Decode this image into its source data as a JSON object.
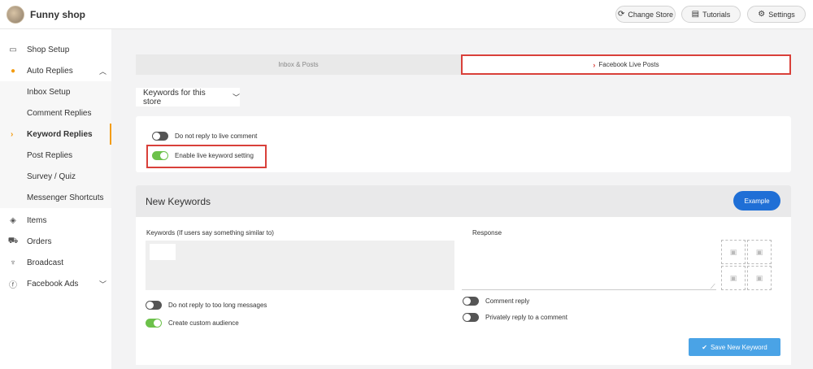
{
  "header": {
    "shop_name": "Funny shop",
    "buttons": {
      "change_store": "Change Store",
      "tutorials": "Tutorials",
      "settings": "Settings"
    }
  },
  "sidebar": {
    "items": [
      {
        "label": "Shop Setup",
        "icon": "shop-icon"
      },
      {
        "label": "Auto Replies",
        "icon": "chat-bubble-icon",
        "expanded": true
      },
      {
        "label": "Inbox Setup"
      },
      {
        "label": "Comment Replies"
      },
      {
        "label": "Keyword Replies",
        "active": true
      },
      {
        "label": "Post Replies"
      },
      {
        "label": "Survey / Quiz"
      },
      {
        "label": "Messenger Shortcuts"
      },
      {
        "label": "Items",
        "icon": "box-icon"
      },
      {
        "label": "Orders",
        "icon": "cart-icon"
      },
      {
        "label": "Broadcast",
        "icon": "microphone-icon"
      },
      {
        "label": "Facebook Ads",
        "icon": "facebook-icon",
        "expanded": false
      }
    ]
  },
  "tabs": {
    "inbox_posts": "Inbox & Posts",
    "facebook_live_posts": "Facebook Live Posts",
    "active": "facebook_live_posts"
  },
  "keyword_scope": {
    "selected": "Keywords for this store"
  },
  "live_settings": {
    "do_not_reply_live": {
      "label": "Do not reply to live comment",
      "on": false
    },
    "enable_live_keyword": {
      "label": "Enable live keyword setting",
      "on": true
    }
  },
  "new_keywords": {
    "title": "New Keywords",
    "example_label": "Example",
    "keywords_label": "Keywords (If users say something similar to)",
    "response_label": "Response",
    "do_not_reply_long": {
      "label": "Do not reply to too long messages",
      "on": false
    },
    "custom_audience": {
      "label": "Create custom audience",
      "on": true
    },
    "comment_reply": {
      "label": "Comment reply",
      "on": false
    },
    "private_reply": {
      "label": "Privately reply to a comment",
      "on": false
    },
    "save_label": "Save New Keyword"
  },
  "colors": {
    "accent_orange": "#f39c12",
    "highlight_red": "#d9403a",
    "primary_blue": "#1f6fd6",
    "save_blue": "#4aa3e6",
    "toggle_green": "#6cc14a"
  }
}
